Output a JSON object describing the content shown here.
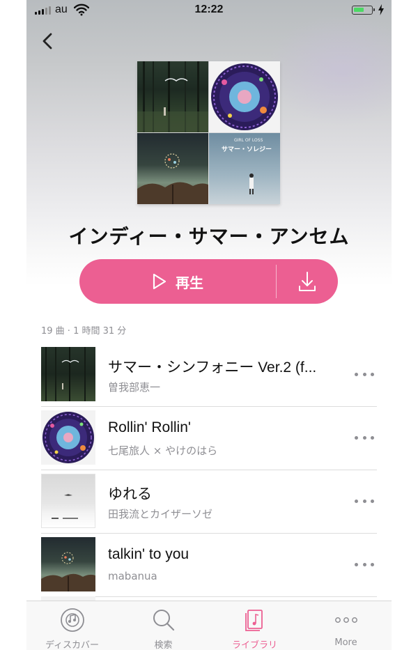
{
  "status_bar": {
    "carrier": "au",
    "time": "12:22"
  },
  "playlist": {
    "title": "インディー・サマー・アンセム",
    "meta": "19 曲 · 1 時間 31 分",
    "play_label": "再生",
    "cover_text": [
      "GIRL OF LOSS",
      "サマー・ソレジー"
    ]
  },
  "tracks": [
    {
      "title": "サマー・シンフォニー Ver.2 (f...",
      "artist": "曽我部恵一",
      "art": "forest"
    },
    {
      "title": "Rollin' Rollin'",
      "artist": "七尾旅人 × やけのはら",
      "art": "vinyl"
    },
    {
      "title": "ゆれる",
      "artist": "田我流とカイザーソゼ",
      "art": "sky"
    },
    {
      "title": "talkin' to you",
      "artist": "mabanua",
      "art": "tree"
    }
  ],
  "tabbar": {
    "items": [
      {
        "label": "ディスカバー",
        "icon": "disc-icon",
        "active": false
      },
      {
        "label": "検索",
        "icon": "search-icon",
        "active": false
      },
      {
        "label": "ライブラリ",
        "icon": "library-icon",
        "active": true
      },
      {
        "label": "More",
        "icon": "more-icon",
        "active": false
      }
    ]
  },
  "colors": {
    "accent": "#ec5f92",
    "secondary_text": "#8e8e93"
  }
}
